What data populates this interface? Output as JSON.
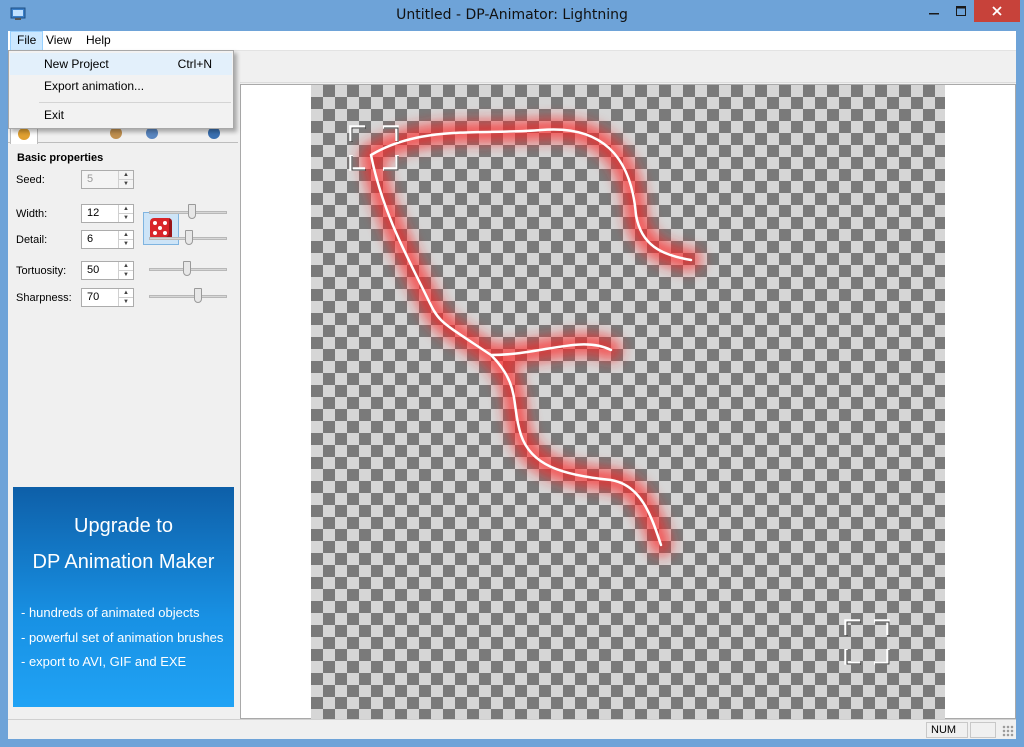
{
  "window": {
    "title": "Untitled - DP-Animator: Lightning"
  },
  "menubar": {
    "file": "File",
    "view": "View",
    "help": "Help"
  },
  "file_menu": {
    "new_project": "New Project",
    "new_project_shortcut": "Ctrl+N",
    "export_animation": "Export animation...",
    "exit": "Exit"
  },
  "panel": {
    "section_title": "Basic properties",
    "seed": {
      "label": "Seed:",
      "value": "5"
    },
    "width": {
      "label": "Width:",
      "value": "12",
      "slider": 0.55
    },
    "detail": {
      "label": "Detail:",
      "value": "6",
      "slider": 0.52
    },
    "tortuosity": {
      "label": "Tortuosity:",
      "value": "50",
      "slider": 0.48
    },
    "sharpness": {
      "label": "Sharpness:",
      "value": "70",
      "slider": 0.64
    }
  },
  "promo": {
    "line1": "Upgrade to",
    "line2": "DP Animation Maker",
    "bullets": [
      "- hundreds of animated objects",
      "- powerful set of animation brushes",
      "- export to AVI, GIF and EXE"
    ]
  },
  "status": {
    "num": "NUM"
  },
  "colors": {
    "accent": "#1891e4",
    "glow": "#ff2a2a",
    "titlebar": "#6ea3d8"
  }
}
